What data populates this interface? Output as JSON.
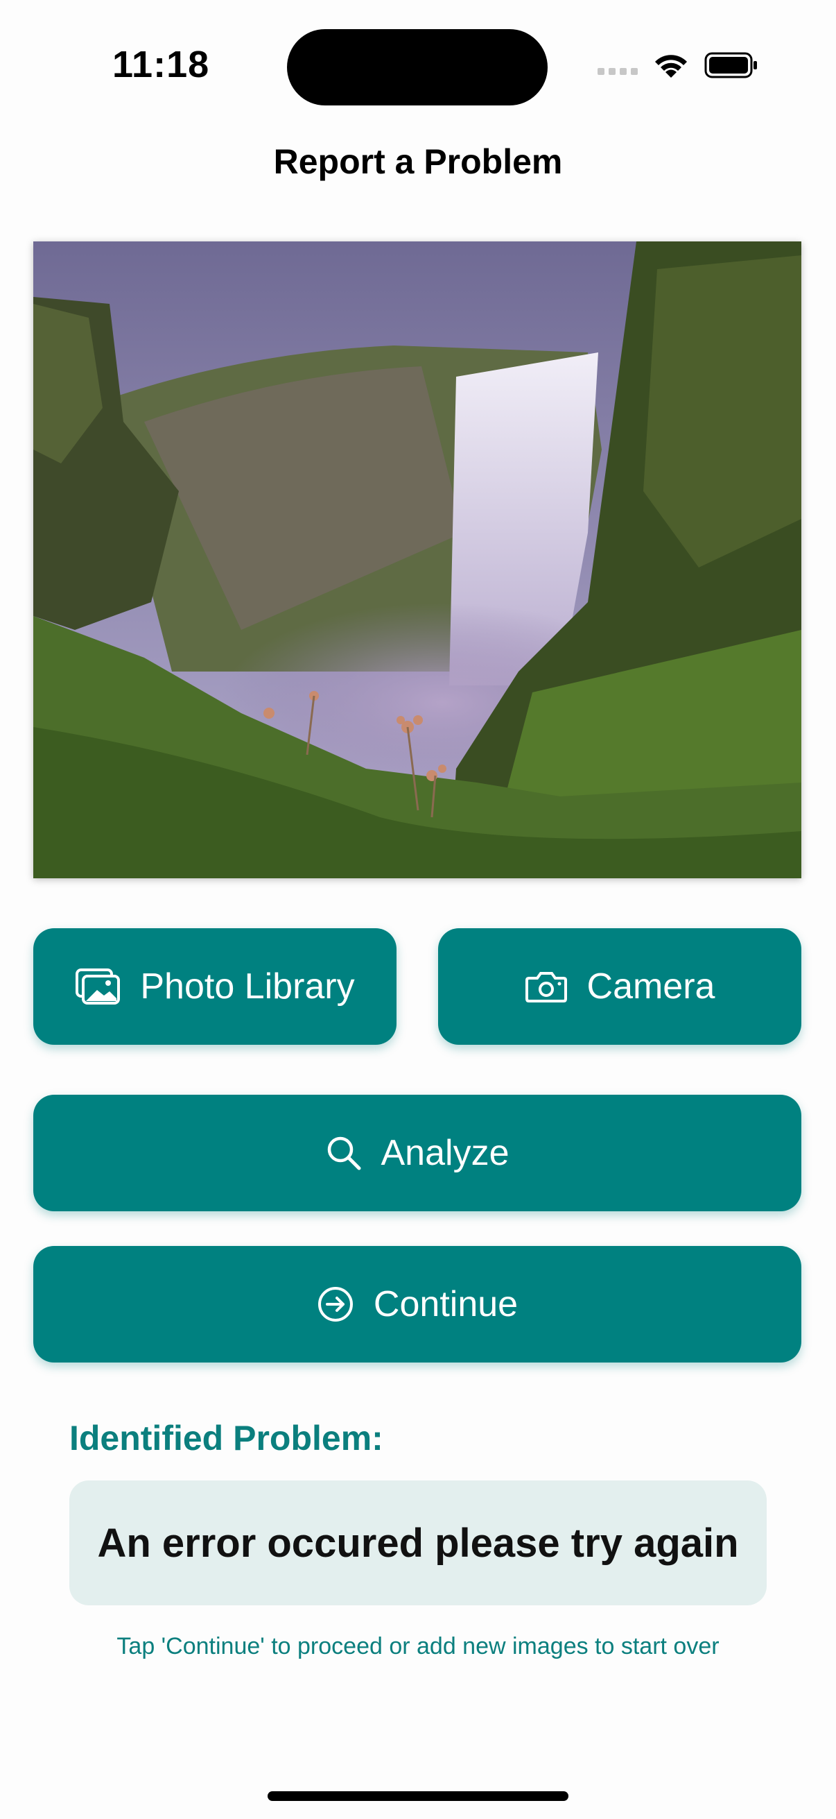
{
  "status_bar": {
    "time": "11:18"
  },
  "nav": {
    "title": "Report a Problem"
  },
  "photo": {
    "subject": "waterfall landscape"
  },
  "buttons": {
    "photo_library": {
      "label": "Photo Library",
      "icon": "photo-library-icon"
    },
    "camera": {
      "label": "Camera",
      "icon": "camera-icon"
    },
    "analyze": {
      "label": "Analyze",
      "icon": "search-icon"
    },
    "continue": {
      "label": "Continue",
      "icon": "arrow-circle-icon"
    }
  },
  "result": {
    "label": "Identified Problem:",
    "message": "An error occured please try again",
    "hint": "Tap 'Continue' to proceed or add new images to start over"
  },
  "colors": {
    "accent": "#008180",
    "accent_text": "#0b7f7e",
    "message_bg": "#e3efee"
  }
}
